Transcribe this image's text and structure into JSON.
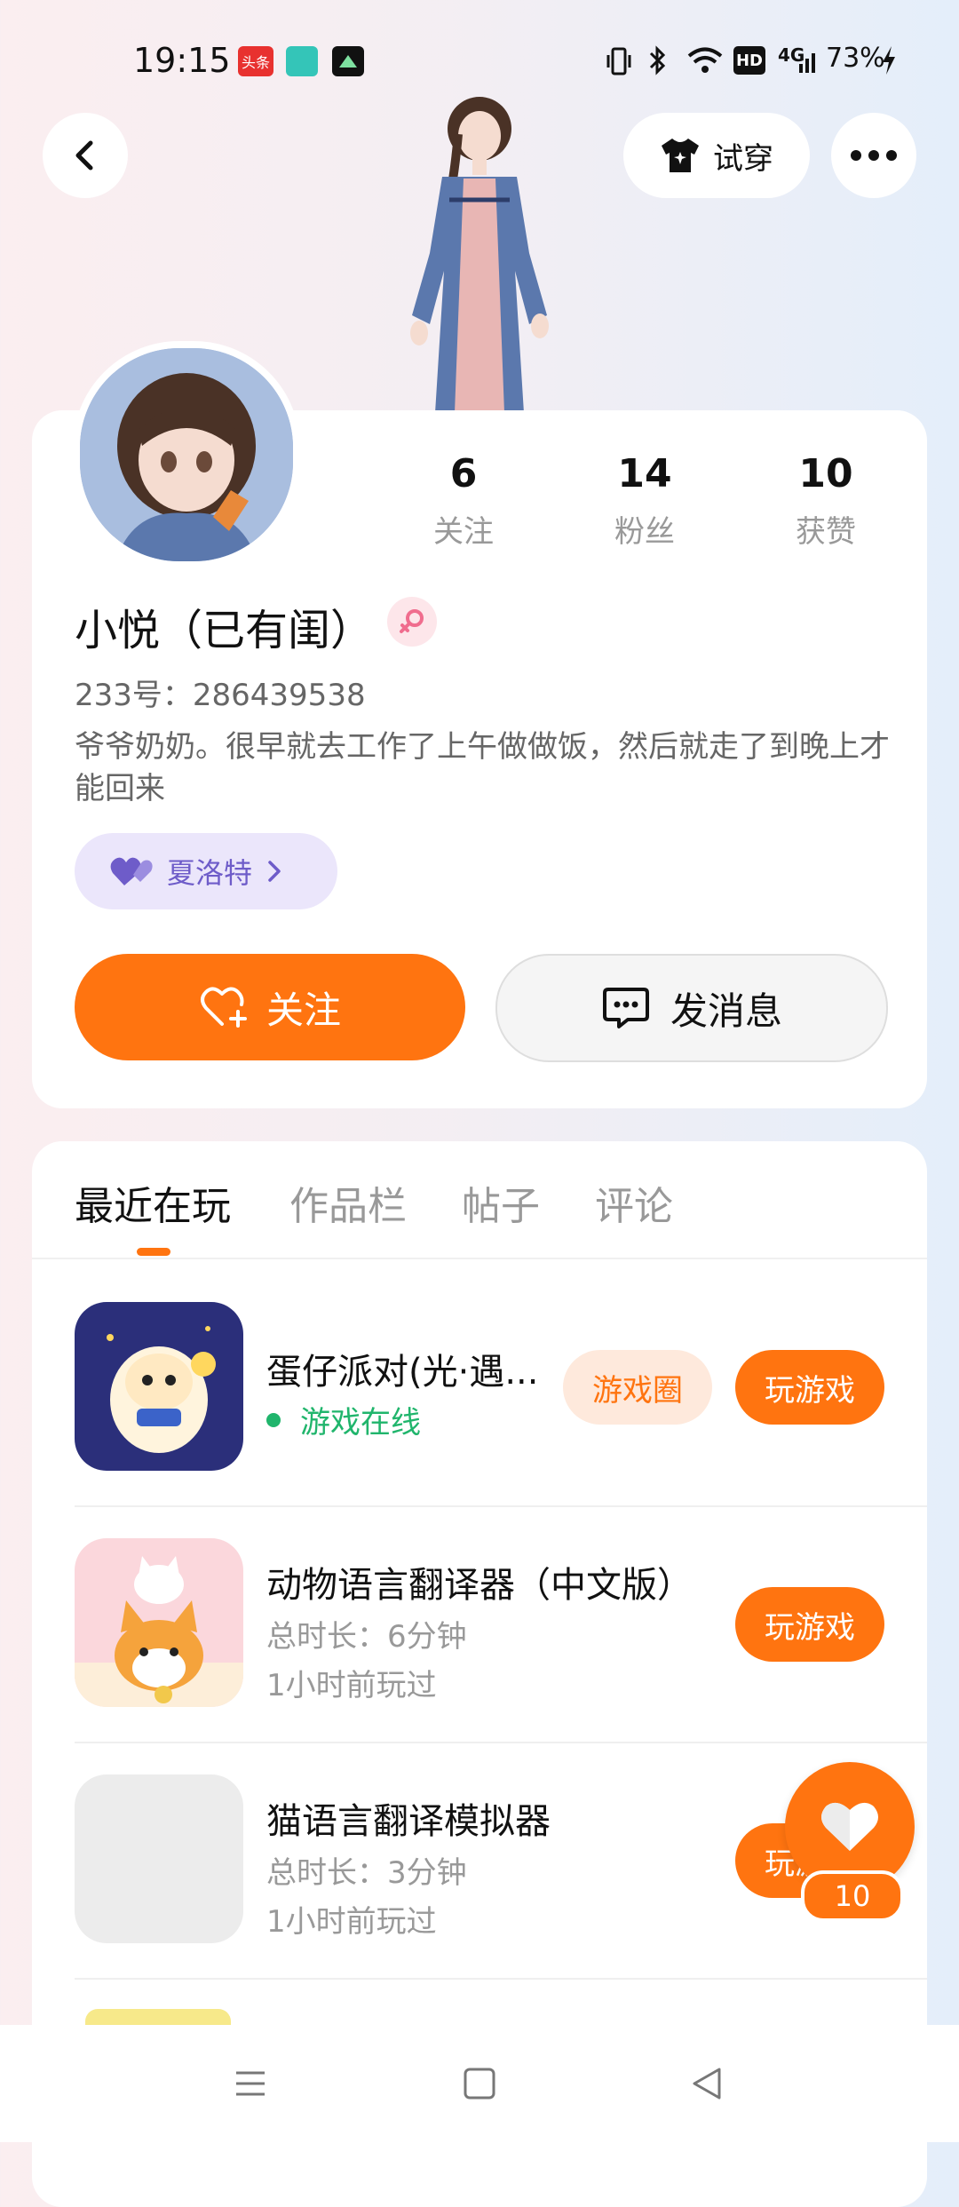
{
  "status_bar": {
    "time": "19:15",
    "battery": "73%",
    "network": "4G",
    "hd": "HD",
    "app_icons": [
      "toutiao-icon",
      "chat-app-icon",
      "game-app-icon"
    ]
  },
  "header": {
    "back_icon": "chevron-left-icon",
    "try_on_label": "试穿",
    "more_icon": "more-icon"
  },
  "profile": {
    "name": "小悦（已有闺）",
    "gender": "female",
    "uid": "233号：286439538",
    "bio": "爷爷奶奶。很早就去工作了上午做做饭，然后就走了到晚上才能回来",
    "tag_label": "夏洛特",
    "stats": [
      {
        "value": "6",
        "label": "关注"
      },
      {
        "value": "14",
        "label": "粉丝"
      },
      {
        "value": "10",
        "label": "获赞"
      }
    ],
    "follow_label": "关注",
    "message_label": "发消息"
  },
  "tabs": [
    {
      "label": "最近在玩",
      "active": true
    },
    {
      "label": "作品栏",
      "active": false
    },
    {
      "label": "帖子",
      "active": false
    },
    {
      "label": "评论",
      "active": false
    }
  ],
  "games": [
    {
      "title": "蛋仔派对(光·遇...",
      "status": "游戏在线",
      "circle_label": "游戏圈",
      "play_label": "玩游戏"
    },
    {
      "title": "动物语言翻译器（中文版）",
      "duration": "总时长：6分钟",
      "last_played": "1小时前玩过",
      "play_label": "玩游戏"
    },
    {
      "title": "猫语言翻译模拟器",
      "duration": "总时长：3分钟",
      "last_played": "1小时前玩过",
      "play_label": "玩游戏"
    }
  ],
  "floating_like": {
    "count": "10"
  },
  "colors": {
    "accent": "#ff7410",
    "online": "#20b56c",
    "tag_bg": "#ebe6fb",
    "tag_text": "#6e5cc9"
  }
}
